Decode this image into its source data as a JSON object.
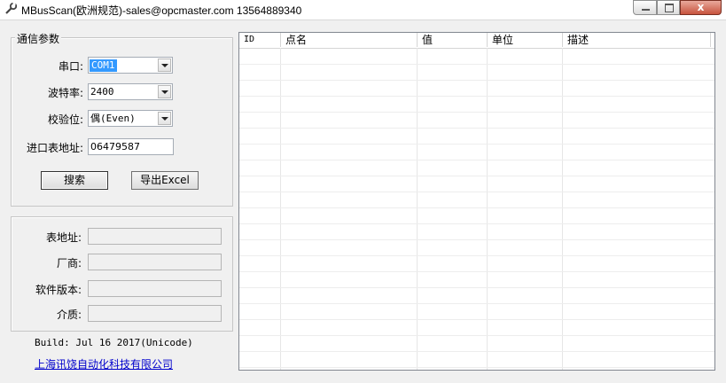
{
  "window": {
    "title": "MBusScan(欧洲规范)-sales@opcmaster.com 13564889340",
    "close_glyph": "x"
  },
  "settings": {
    "group_title": "通信参数",
    "port_label": "串口:",
    "port_value": "COM1",
    "baud_label": "波特率:",
    "baud_value": "2400",
    "parity_label": "校验位:",
    "parity_value": "偶(Even)",
    "address_label": "进口表地址:",
    "address_value": "06479587",
    "search_button": "搜索",
    "export_button": "导出Excel"
  },
  "info": {
    "meter_address_label": "表地址:",
    "vendor_label": "厂商:",
    "version_label": "软件版本:",
    "medium_label": "介质:"
  },
  "footer": {
    "build": "Build: Jul 16 2017(Unicode)",
    "company_link": "上海讯饶自动化科技有限公司"
  },
  "table": {
    "columns": [
      "ID",
      "点名",
      "值",
      "单位",
      "描述"
    ],
    "rows": []
  }
}
